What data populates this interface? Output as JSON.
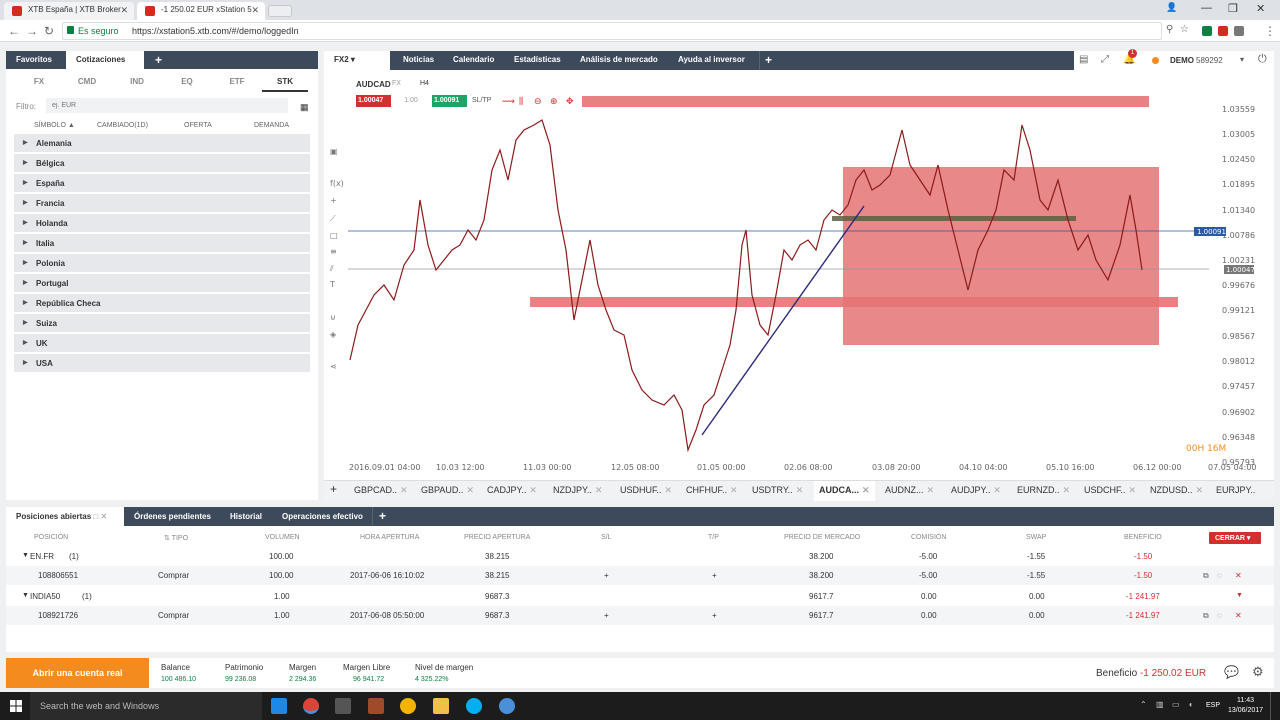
{
  "browser": {
    "tabs": [
      {
        "title": "XTB España | XTB Broker"
      },
      {
        "title": "-1 250.02 EUR xStation 5"
      }
    ],
    "secure_label": "Es seguro",
    "url": "https://xstation5.xtb.com/#/demo/loggedIn"
  },
  "left_panel": {
    "tabs": [
      "Favoritos",
      "Cotizaciones"
    ],
    "subtabs": [
      "FX",
      "CMD",
      "IND",
      "EQ",
      "ETF",
      "STK"
    ],
    "active_subtab": "STK",
    "filter_label": "Filtro:",
    "filter_placeholder": "ej. EUR",
    "columns": [
      "SÍMBOLO ▲",
      "CAMBIADO(1D)",
      "OFERTA",
      "DEMANDA"
    ],
    "countries": [
      "Alemania",
      "Bélgica",
      "España",
      "Francia",
      "Holanda",
      "Italia",
      "Polonia",
      "Portugal",
      "República Checa",
      "Suiza",
      "UK",
      "USA"
    ]
  },
  "chart_panel": {
    "tabs": [
      "FX2",
      "Noticias",
      "Calendario",
      "Estadísticas",
      "Análisis de mercado",
      "Ayuda al inversor"
    ],
    "account_mode": "DEMO",
    "account_number": "589292",
    "notification_count": "1",
    "symbol": "AUDCAD",
    "symbol_type": "FX",
    "timeframe": "H4",
    "sell_price": "1.00047",
    "volume": "1.00",
    "buy_price": "1.00091",
    "sltp_label": "SL/TP",
    "price_axis": [
      "1.03559",
      "1.03005",
      "1.02450",
      "1.01895",
      "1.01340",
      "1.00786",
      "1.00231",
      "0.99676",
      "0.99121",
      "0.98567",
      "0.98012",
      "0.97457",
      "0.96902",
      "0.96348",
      "0.95793"
    ],
    "ask_marker": "1.00091",
    "bid_marker": "1.00047",
    "time_axis": [
      "2016.09.01 04:00",
      "10.03 12:00",
      "11.03 00:00",
      "12.05 08:00",
      "01.05 00:00",
      "02.06 08:00",
      "03.08 20:00",
      "04.10 04:00",
      "05.10 16:00",
      "06.12 00:00",
      "07.05 04:00"
    ],
    "countdown": "00H 16M",
    "instruments": [
      "GBPCAD..",
      "GBPAUD..",
      "CADJPY..",
      "NZDJPY..",
      "USDHUF..",
      "CHFHUF..",
      "USDTRY..",
      "AUDCA...",
      "AUDNZ...",
      "AUDJPY..",
      "EURNZD..",
      "USDCHF..",
      "NZDUSD..",
      "EURJPY.."
    ],
    "active_instrument": "AUDCA..."
  },
  "positions": {
    "tabs": [
      "Posiciones abiertas",
      "Órdenes pendientes",
      "Historial",
      "Operaciones efectivo"
    ],
    "columns": [
      "POSICIÓN",
      "TIPO",
      "VOLUMEN",
      "HORA APERTURA",
      "PRECIO APERTURA",
      "S/L",
      "T/P",
      "PRECIO DE MERCADO",
      "COMISIÓN",
      "SWAP",
      "BENEFICIO"
    ],
    "close_label": "CERRAR",
    "rows": [
      {
        "position": "EN.FR",
        "count": "(1)",
        "type": "",
        "volume": "100.00",
        "open_time": "",
        "open_price": "38.215",
        "sl": "",
        "tp": "",
        "market": "38.200",
        "commission": "-5.00",
        "swap": "-1.55",
        "profit": "-1.50",
        "group": true
      },
      {
        "position": "108806551",
        "count": "",
        "type": "Comprar",
        "volume": "100.00",
        "open_time": "2017-06-06 16:10:02",
        "open_price": "38.215",
        "sl": "+",
        "tp": "+",
        "market": "38.200",
        "commission": "-5.00",
        "swap": "-1.55",
        "profit": "-1.50",
        "group": false
      },
      {
        "position": "INDIA50",
        "count": "(1)",
        "type": "",
        "volume": "1.00",
        "open_time": "",
        "open_price": "9687.3",
        "sl": "",
        "tp": "",
        "market": "9617.7",
        "commission": "0.00",
        "swap": "0.00",
        "profit": "-1 241.97",
        "group": true
      },
      {
        "position": "108921726",
        "count": "",
        "type": "Comprar",
        "volume": "1.00",
        "open_time": "2017-06-08 05:50:00",
        "open_price": "9687.3",
        "sl": "+",
        "tp": "+",
        "market": "9617.7",
        "commission": "0.00",
        "swap": "0.00",
        "profit": "-1 241.97",
        "group": false
      }
    ]
  },
  "footer": {
    "open_account": "Abrir una cuenta real",
    "items": [
      {
        "label": "Balance",
        "value": "100 486.10"
      },
      {
        "label": "Patrimonio",
        "value": "99 236.08"
      },
      {
        "label": "Margen",
        "value": "2 294.36"
      },
      {
        "label": "Margen Libre",
        "value": "96 941.72"
      },
      {
        "label": "Nivel de margen",
        "value": "4 325.22%"
      }
    ],
    "profit_label": "Beneficio",
    "profit_value": "-1 250.02 EUR"
  },
  "taskbar": {
    "search_placeholder": "Search the web and Windows",
    "language": "ESP",
    "time": "11:43",
    "date": "13/06/2017"
  },
  "colors": {
    "header_bg": "#3c4a5c",
    "sell_red": "#d32f2f",
    "buy_green": "#21a366",
    "orange": "#f48b1f",
    "zone_red": "#e57373"
  }
}
